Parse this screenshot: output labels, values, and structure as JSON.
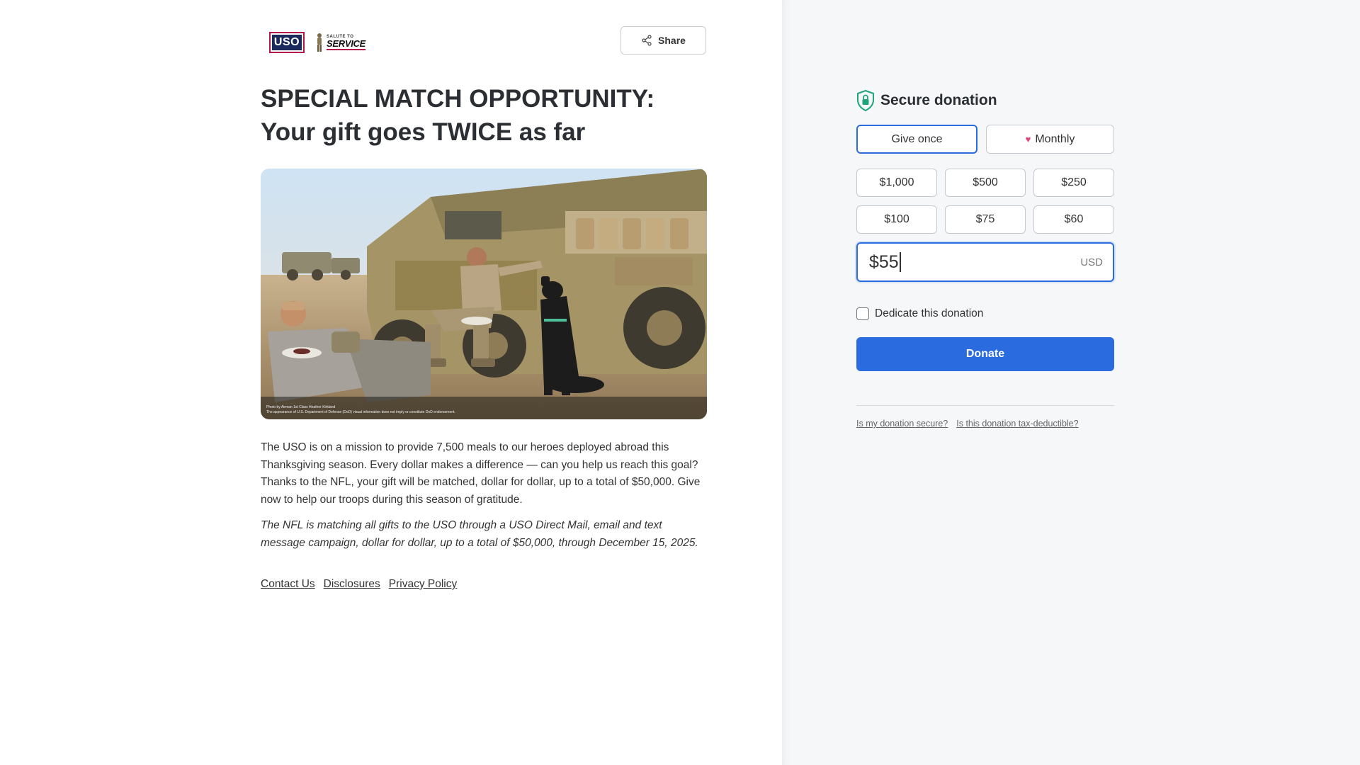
{
  "header": {
    "logo_uso_text": "USO",
    "logo_sts_small": "SALUTE TO",
    "logo_sts_big": "SERVICE",
    "share_label": "Share"
  },
  "headline": {
    "line1": "SPECIAL MATCH OPPORTUNITY:",
    "line2": "Your gift goes TWICE as far"
  },
  "photo": {
    "credit_line1": "Photo by Airman 1st Class Heather Kirkland",
    "credit_line2": "The appearance of U.S. Department of Defense (DoD) visual information does not imply or constitute DoD endorsement."
  },
  "body": {
    "paragraph1": "The USO is on a mission to provide 7,500 meals to our heroes deployed abroad this Thanksgiving season. Every dollar makes a difference — can you help us reach this goal? Thanks to the NFL, your gift will be matched, dollar for dollar, up to a total of $50,000. Give now to help our troops during this season of gratitude.",
    "paragraph2": "The NFL is matching all gifts to the USO through a USO Direct Mail, email and text message campaign, dollar for dollar, up to a total of $50,000, through December 15, 2025."
  },
  "footer": {
    "links": [
      "Contact Us",
      "Disclosures",
      "Privacy Policy"
    ]
  },
  "donation": {
    "title": "Secure donation",
    "frequency": {
      "once_label": "Give once",
      "monthly_label": "Monthly",
      "selected": "once"
    },
    "amounts": [
      "$1,000",
      "$500",
      "$250",
      "$100",
      "$75",
      "$60"
    ],
    "custom_value": "$55",
    "currency": "USD",
    "dedicate_label": "Dedicate this donation",
    "dedicate_checked": false,
    "donate_label": "Donate",
    "help_links": [
      "Is my donation secure?",
      "Is this donation tax-deductible?"
    ]
  },
  "colors": {
    "accent": "#2b6be0",
    "heart": "#e0457b",
    "shield": "#1fa37a",
    "uso_navy": "#1b2a5c",
    "uso_border": "#b3164b"
  }
}
